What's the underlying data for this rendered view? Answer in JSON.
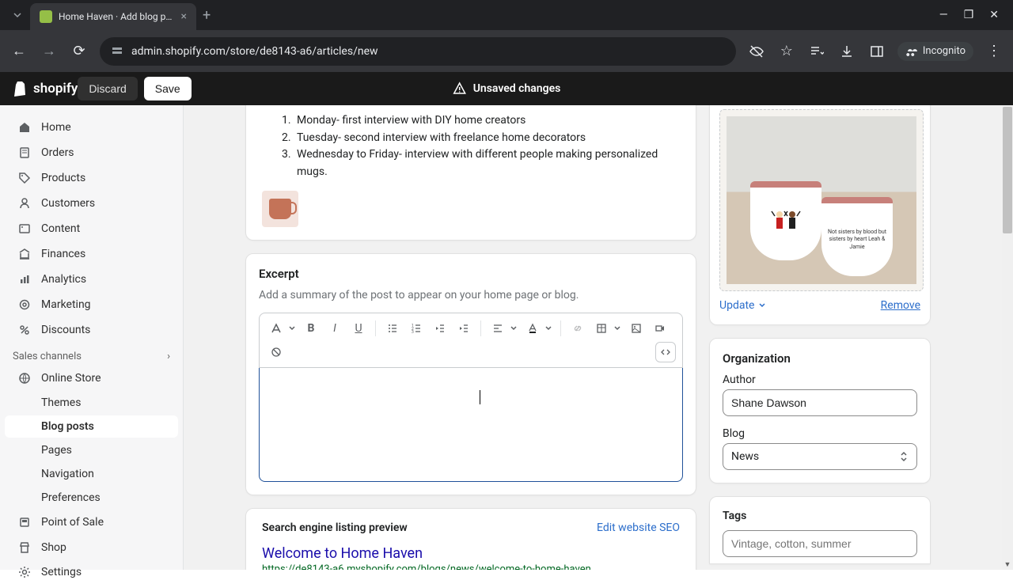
{
  "browser": {
    "tab_title": "Home Haven · Add blog post · ",
    "url": "admin.shopify.com/store/de8143-a6/articles/new",
    "incognito_label": "Incognito"
  },
  "topbar": {
    "logo_text": "shopify",
    "unsaved_text": "Unsaved changes",
    "discard_label": "Discard",
    "save_label": "Save"
  },
  "sidebar": {
    "items": [
      {
        "label": "Home"
      },
      {
        "label": "Orders"
      },
      {
        "label": "Products"
      },
      {
        "label": "Customers"
      },
      {
        "label": "Content"
      },
      {
        "label": "Finances"
      },
      {
        "label": "Analytics"
      },
      {
        "label": "Marketing"
      },
      {
        "label": "Discounts"
      }
    ],
    "section_label": "Sales channels",
    "online_store": "Online Store",
    "online_store_sub": [
      {
        "label": "Themes"
      },
      {
        "label": "Blog posts"
      },
      {
        "label": "Pages"
      },
      {
        "label": "Navigation"
      },
      {
        "label": "Preferences"
      }
    ],
    "pos": "Point of Sale",
    "shop": "Shop",
    "settings": "Settings"
  },
  "content": {
    "list_items": [
      "Monday- first interview with DIY home creators",
      "Tuesday- second interview with freelance home decorators",
      "Wednesday to Friday- interview with different people making personalized mugs."
    ]
  },
  "excerpt": {
    "title": "Excerpt",
    "help": "Add a summary of the post to appear on your home page or blog."
  },
  "seo": {
    "section_title": "Search engine listing preview",
    "edit_label": "Edit website SEO",
    "page_title": "Welcome to Home Haven",
    "url": "https://de8143-a6.myshopify.com/blogs/news/welcome-to-home-haven"
  },
  "featured_image": {
    "mug_text": "Not sisters by blood but sisters by heart Leah & Jamie",
    "update_label": "Update",
    "remove_label": "Remove"
  },
  "organization": {
    "section_title": "Organization",
    "author_label": "Author",
    "author_value": "Shane Dawson",
    "blog_label": "Blog",
    "blog_value": "News",
    "tags_label": "Tags",
    "tags_placeholder": "Vintage, cotton, summer"
  }
}
